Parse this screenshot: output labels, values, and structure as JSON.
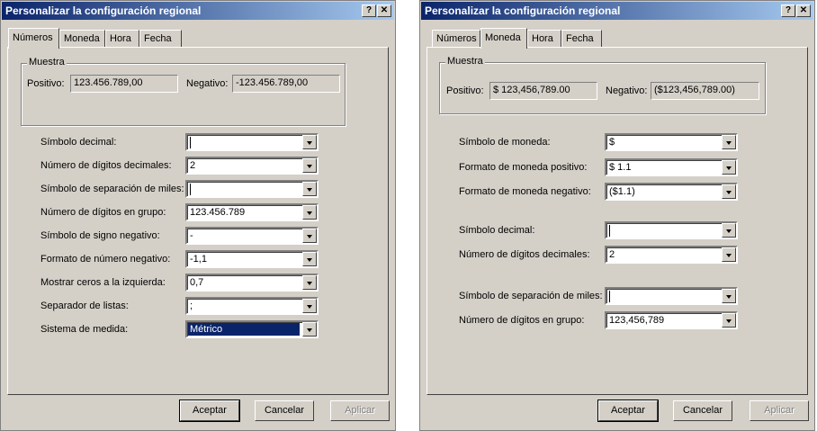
{
  "left_dialog": {
    "title": "Personalizar la configuración regional",
    "help_label": "?",
    "close_label": "✕",
    "tabs": [
      "Números",
      "Moneda",
      "Hora",
      "Fecha"
    ],
    "active_tab": "Números",
    "sample_group": {
      "title": "Muestra",
      "positive_label": "Positivo:",
      "positive_value": "123.456.789,00",
      "negative_label": "Negativo:",
      "negative_value": "-123.456.789,00"
    },
    "fields": [
      {
        "label": "Símbolo decimal:",
        "value": "",
        "caret": true
      },
      {
        "label": "Número de dígitos decimales:",
        "value": "2"
      },
      {
        "label": "Símbolo de separación de miles:",
        "value": "",
        "caret": true
      },
      {
        "label": "Número de dígitos en grupo:",
        "value": "123.456.789"
      },
      {
        "label": "Símbolo de signo negativo:",
        "value": "-"
      },
      {
        "label": "Formato de número negativo:",
        "value": "-1,1"
      },
      {
        "label": "Mostrar ceros a la izquierda:",
        "value": "0,7"
      },
      {
        "label": "Separador de listas:",
        "value": ";"
      },
      {
        "label": "Sistema de medida:",
        "value": "Métrico",
        "selected": true
      }
    ],
    "buttons": {
      "ok": "Aceptar",
      "cancel": "Cancelar",
      "apply": "Aplicar"
    }
  },
  "right_dialog": {
    "title": "Personalizar la configuración regional",
    "help_label": "?",
    "close_label": "✕",
    "tabs": [
      "Números",
      "Moneda",
      "Hora",
      "Fecha"
    ],
    "active_tab": "Moneda",
    "sample_group": {
      "title": "Muestra",
      "positive_label": "Positivo:",
      "positive_value": "$ 123,456,789.00",
      "negative_label": "Negativo:",
      "negative_value": "($123,456,789.00)"
    },
    "fields": [
      {
        "label": "Símbolo de moneda:",
        "value": "$"
      },
      {
        "label": "Formato de moneda positivo:",
        "value": "$ 1.1"
      },
      {
        "label": "Formato de moneda negativo:",
        "value": "($1.1)"
      },
      {
        "label": "Símbolo decimal:",
        "value": "",
        "caret": true
      },
      {
        "label": "Número de dígitos decimales:",
        "value": "2"
      },
      {
        "label": "Símbolo de separación de miles:",
        "value": "",
        "caret": true
      },
      {
        "label": "Número de dígitos en grupo:",
        "value": "123,456,789"
      }
    ],
    "buttons": {
      "ok": "Aceptar",
      "cancel": "Cancelar",
      "apply": "Aplicar"
    }
  }
}
